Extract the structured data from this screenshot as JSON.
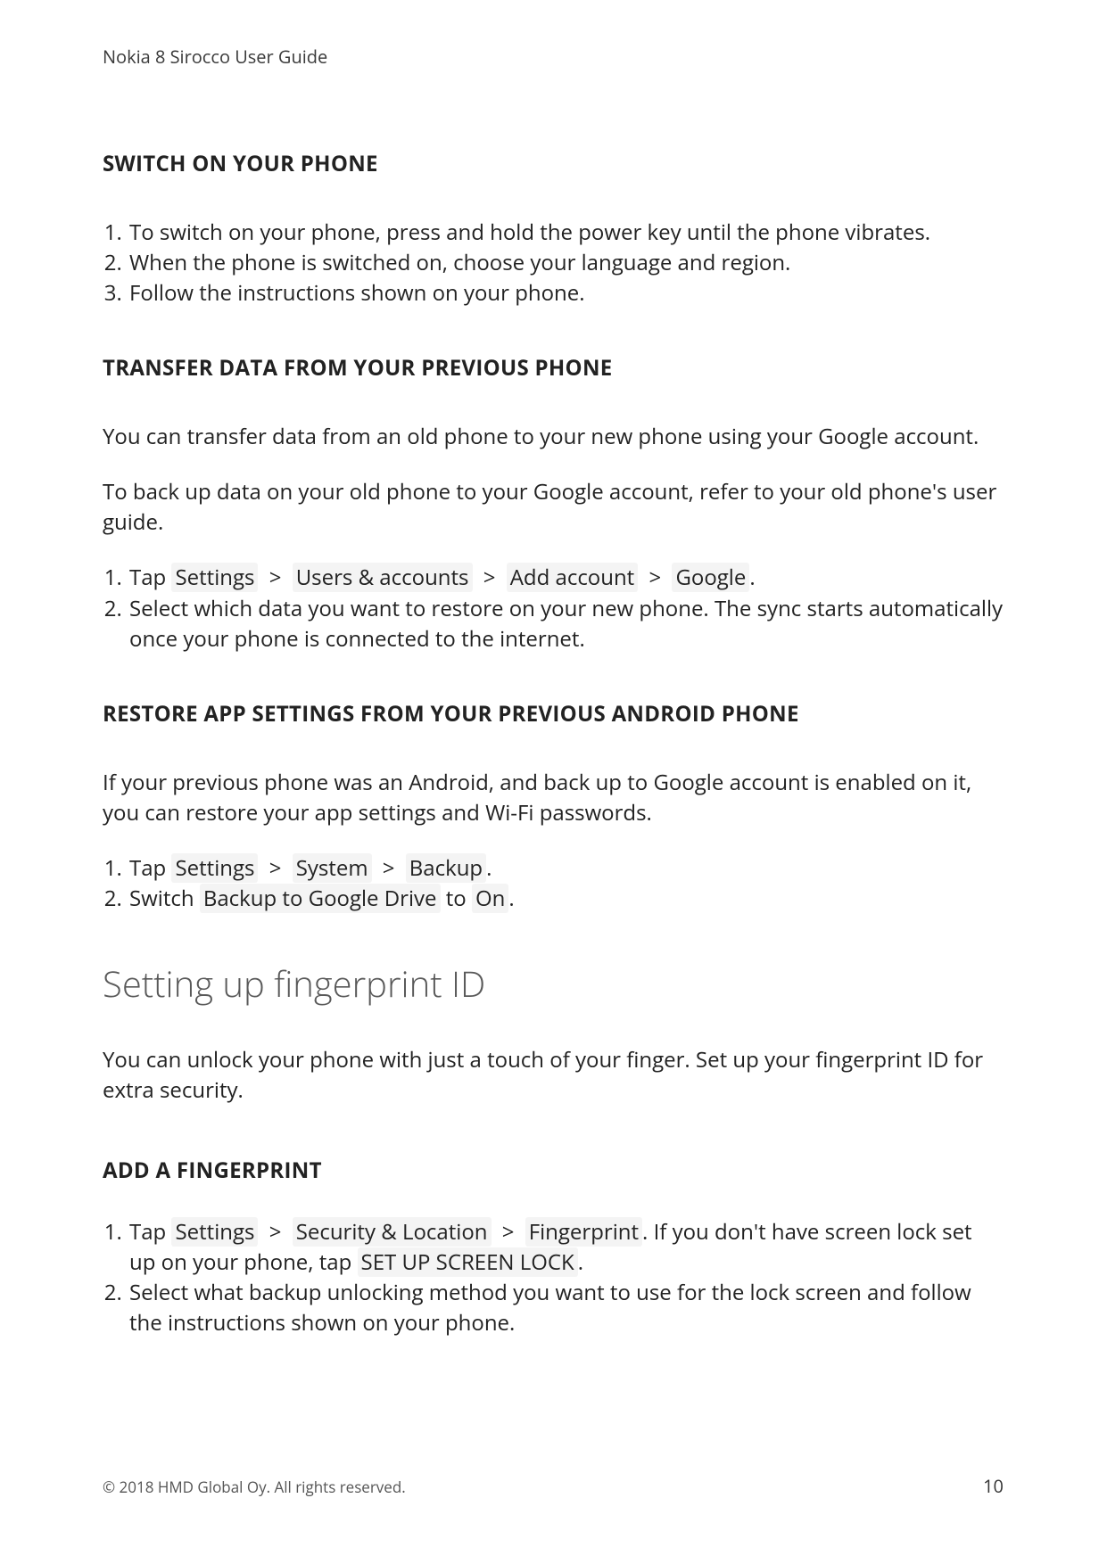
{
  "header": "Nokia 8 Sirocco User Guide",
  "sections": {
    "switch_on": {
      "title": "SWITCH ON YOUR PHONE",
      "steps": [
        "To switch on your phone, press and hold the power key until the phone vibrates.",
        "When the phone is switched on, choose your language and region.",
        "Follow the instructions shown on your phone."
      ]
    },
    "transfer": {
      "title": "TRANSFER DATA FROM YOUR PREVIOUS PHONE",
      "para1": "You can transfer data from an old phone to your new phone using your Google account.",
      "para2": "To back up data on your old phone to your Google account, refer to your old phone's user guide.",
      "step1": {
        "pre": "Tap ",
        "k1": "Settings",
        "k2": "Users & accounts",
        "k3": "Add account",
        "k4": "Google",
        "post": "."
      },
      "step2": "Select which data you want to restore on your new phone. The sync starts automatically once your phone is connected to the internet."
    },
    "restore": {
      "title": "RESTORE APP SETTINGS FROM YOUR PREVIOUS ANDROID PHONE",
      "para1": "If your previous phone was an Android, and back up to Google account is enabled on it, you can restore your app settings and Wi-Fi passwords.",
      "step1": {
        "pre": "Tap ",
        "k1": "Settings",
        "k2": "System",
        "k3": "Backup",
        "post": "."
      },
      "step2": {
        "pre": "Switch ",
        "k1": "Backup to Google Drive",
        "mid": " to ",
        "k2": "On",
        "post": "."
      }
    },
    "fingerprint_topic": "Setting up fingerprint ID",
    "fingerprint_intro": "You can unlock your phone with just a touch of your finger. Set up your fingerprint ID for extra security.",
    "add_fp": {
      "title": "ADD A FINGERPRINT",
      "step1": {
        "pre": "Tap ",
        "k1": "Settings",
        "k2": "Security & Location",
        "k3": "Fingerprint",
        "mid": ". If you don't have screen lock set up on your phone, tap ",
        "k4": "SET UP SCREEN LOCK",
        "post": "."
      },
      "step2": "Select what backup unlocking method you want to use for the lock screen and follow the instructions shown on your phone."
    }
  },
  "sep": ">",
  "footer": {
    "copyright": "© 2018 HMD Global Oy. All rights reserved.",
    "page": "10"
  }
}
